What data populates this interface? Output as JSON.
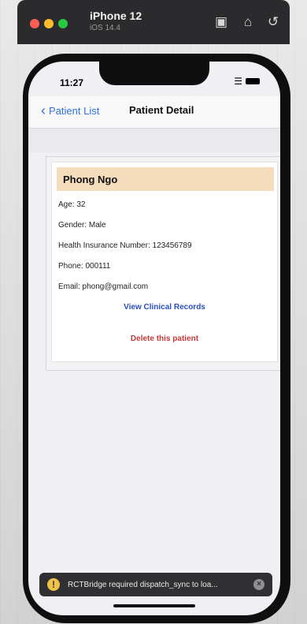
{
  "simulator": {
    "device_name": "iPhone 12",
    "os_version": "iOS 14.4",
    "icons": [
      "screenshot-icon",
      "home-icon",
      "rotate-icon"
    ]
  },
  "status_bar": {
    "time": "11:27"
  },
  "navbar": {
    "back_label": "Patient List",
    "title": "Patient Detail"
  },
  "patient": {
    "name": "Phong Ngo",
    "age": "Age: 32",
    "gender": "Gender: Male",
    "insurance": "Health Insurance Number: 123456789",
    "phone": "Phone: 000111",
    "email": "Email: phong@gmail.com"
  },
  "actions": {
    "view_records": "View Clinical Records",
    "delete": "Delete this patient"
  },
  "toast": {
    "message": "RCTBridge required dispatch_sync to loa..."
  },
  "colors": {
    "accent": "#2f73e0",
    "name_highlight": "#f4dcbc",
    "link_blue": "#2c4fbf",
    "danger": "#c13a3a",
    "warning": "#f1c24a"
  }
}
